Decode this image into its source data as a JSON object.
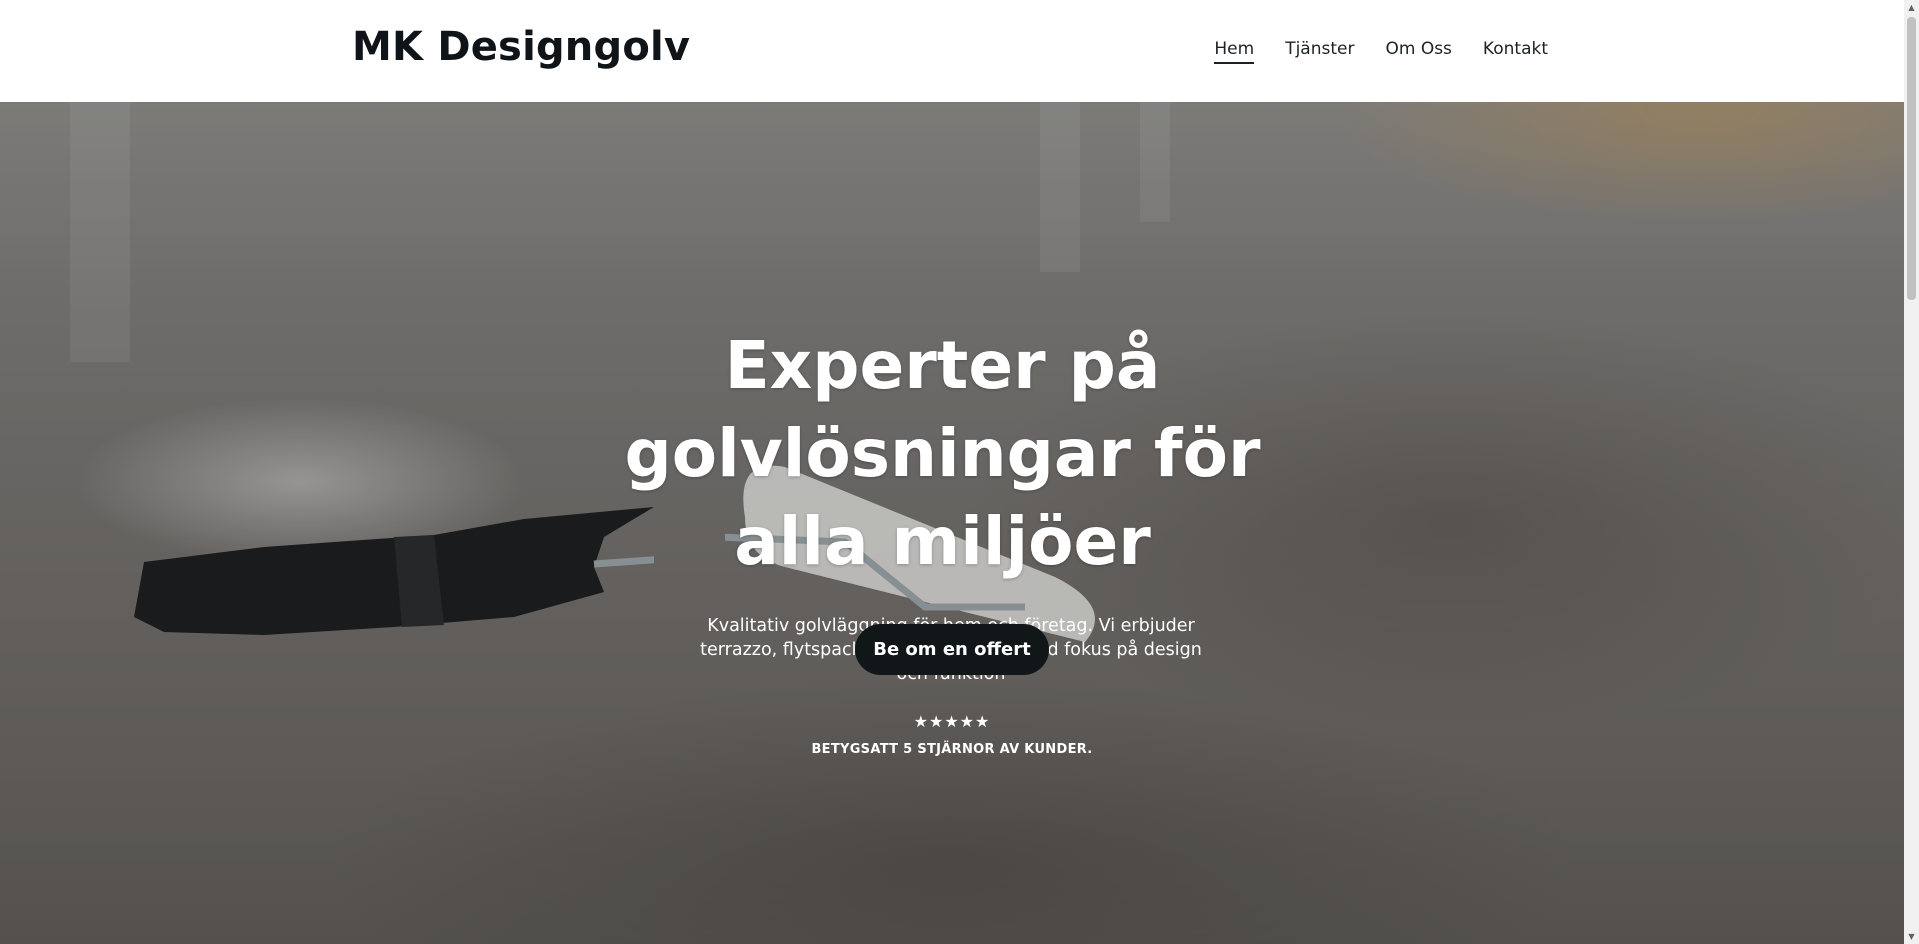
{
  "header": {
    "brand": "MK Designgolv",
    "nav": [
      {
        "label": "Hem",
        "active": true
      },
      {
        "label": "Tjänster",
        "active": false
      },
      {
        "label": "Om Oss",
        "active": false
      },
      {
        "label": "Kontakt",
        "active": false
      }
    ]
  },
  "hero": {
    "title_lines": [
      "Experter på",
      "golvlösningar för",
      "alla miljöer"
    ],
    "subtitle_lines": [
      "Kvalitativ golvläggning för hem och företag. Vi erbjuder",
      "terrazzo, flytspackling & Epoxygolv  med fokus på design",
      "och funktion"
    ],
    "cta_label": "Be om en offert",
    "stars": "★★★★★",
    "rating_text": "BETYGSATT 5 STJÄRNOR AV KUNDER."
  },
  "scrollbar": {
    "up_icon": "▲",
    "down_icon": "▼"
  }
}
